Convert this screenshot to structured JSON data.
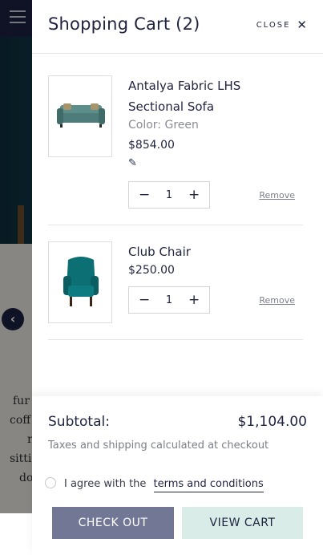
{
  "background": {
    "text_lines": [
      "fur",
      "coff",
      "r",
      "sitti",
      "do"
    ]
  },
  "cart": {
    "title": "Shopping Cart (2)",
    "close_label": "CLOSE",
    "items": [
      {
        "name": "Antalya Fabric LHS Sectional Sofa",
        "color_label": "Color: Green",
        "price": "$854.00",
        "quantity": "1",
        "remove_label": "Remove",
        "thumb_icon": "sofa-image"
      },
      {
        "name": "Club Chair",
        "price": "$250.00",
        "quantity": "1",
        "remove_label": "Remove",
        "thumb_icon": "chair-image"
      }
    ],
    "subtotal_label": "Subtotal:",
    "subtotal_value": "$1,104.00",
    "tax_note": "Taxes and shipping calculated at checkout",
    "agree_text": "I agree with the",
    "terms_link": "terms and conditions",
    "checkout_label": "CHECK OUT",
    "view_cart_label": "VIEW CART"
  },
  "colors": {
    "navy": "#1f2340",
    "checkout_bg": "#727795",
    "view_cart_bg": "#d9ece7"
  }
}
